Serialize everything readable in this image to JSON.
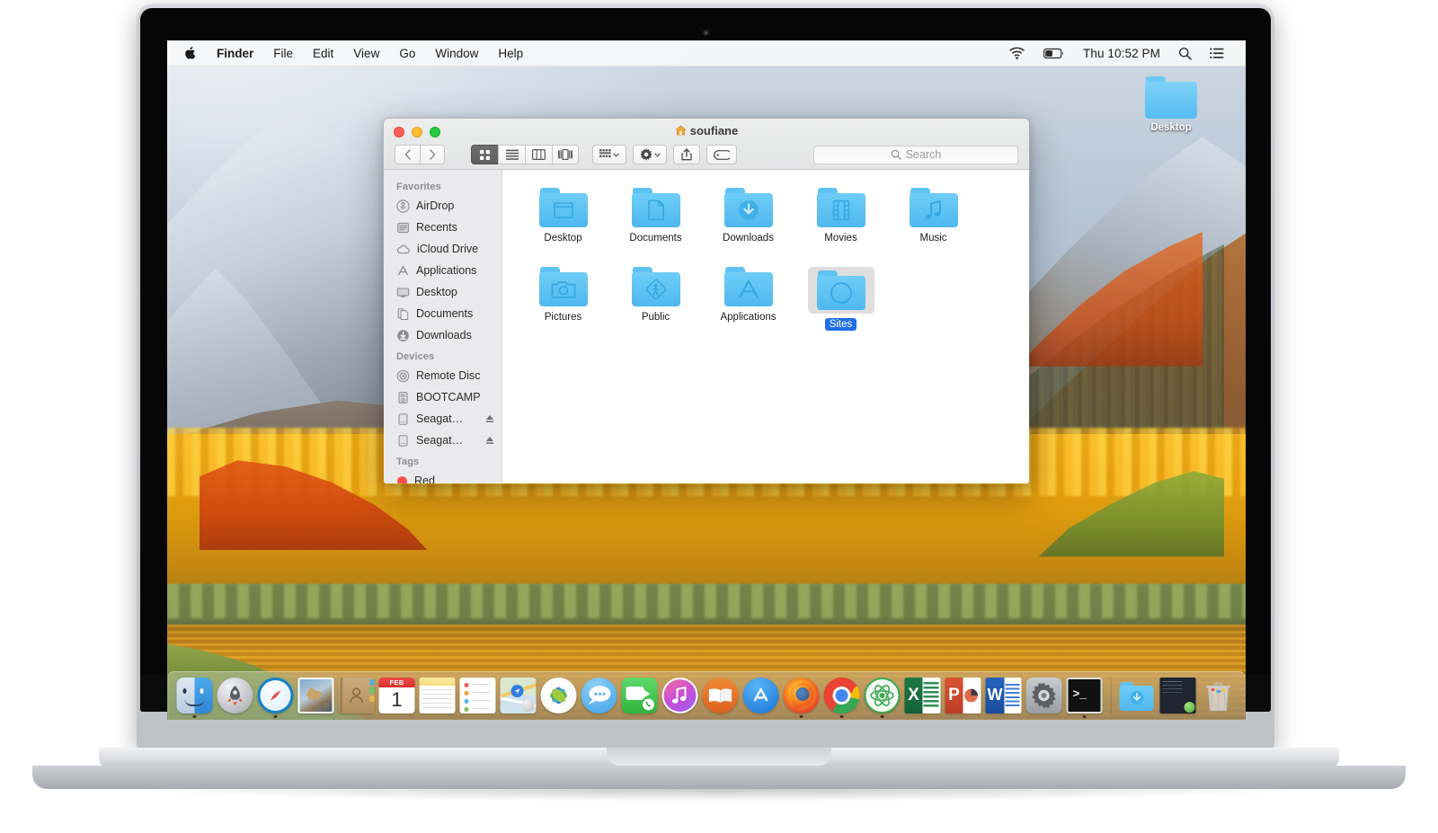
{
  "device": {
    "brand": "MacBook Pro"
  },
  "menubar": {
    "apple": "",
    "items": [
      {
        "label": "Finder",
        "bold": true
      },
      {
        "label": "File",
        "bold": false
      },
      {
        "label": "Edit",
        "bold": false
      },
      {
        "label": "View",
        "bold": false
      },
      {
        "label": "Go",
        "bold": false
      },
      {
        "label": "Window",
        "bold": false
      },
      {
        "label": "Help",
        "bold": false
      }
    ],
    "status": {
      "wifi_icon": "wifi-icon",
      "battery_icon": "battery-icon",
      "clock": "Thu 10:52 PM",
      "search_icon": "spotlight-search-icon",
      "list_icon": "notification-center-icon"
    }
  },
  "desktop": {
    "icons": [
      {
        "label": "Desktop",
        "type": "folder"
      }
    ]
  },
  "finder": {
    "title": "soufiane",
    "title_icon": "home-icon",
    "traffic": {
      "close": "close-button",
      "minimize": "minimize-button",
      "zoom": "zoom-button"
    },
    "toolbar": {
      "back": "back-button",
      "forward": "forward-button",
      "views": [
        {
          "name": "icon-view",
          "active": true
        },
        {
          "name": "list-view",
          "active": false
        },
        {
          "name": "column-view",
          "active": false
        },
        {
          "name": "gallery-view",
          "active": false
        }
      ],
      "arrange": "arrange-by-button",
      "action": "action-gear-button",
      "share": "share-button",
      "tags": "tags-button"
    },
    "search": {
      "placeholder": "Search",
      "value": ""
    },
    "sidebar": [
      {
        "header": "Favorites",
        "items": [
          {
            "label": "AirDrop",
            "icon": "airdrop-icon"
          },
          {
            "label": "Recents",
            "icon": "recents-icon"
          },
          {
            "label": "iCloud Drive",
            "icon": "icloud-icon"
          },
          {
            "label": "Applications",
            "icon": "applications-icon"
          },
          {
            "label": "Desktop",
            "icon": "desktop-icon"
          },
          {
            "label": "Documents",
            "icon": "documents-icon"
          },
          {
            "label": "Downloads",
            "icon": "downloads-icon"
          }
        ]
      },
      {
        "header": "Devices",
        "items": [
          {
            "label": "Remote Disc",
            "icon": "remote-disc-icon",
            "eject": false
          },
          {
            "label": "BOOTCAMP",
            "icon": "drive-icon",
            "eject": false
          },
          {
            "label": "Seagat…",
            "icon": "drive-icon",
            "eject": true
          },
          {
            "label": "Seagat…",
            "icon": "drive-icon",
            "eject": true
          }
        ]
      },
      {
        "header": "Tags",
        "items": [
          {
            "label": "Red",
            "icon": "red-tag-dot"
          }
        ]
      }
    ],
    "files": [
      {
        "label": "Desktop",
        "glyph": "window",
        "selected": false
      },
      {
        "label": "Documents",
        "glyph": "page",
        "selected": false
      },
      {
        "label": "Downloads",
        "glyph": "arrow",
        "selected": false
      },
      {
        "label": "Movies",
        "glyph": "film",
        "selected": false
      },
      {
        "label": "Music",
        "glyph": "note",
        "selected": false
      },
      {
        "label": "Pictures",
        "glyph": "camera",
        "selected": false
      },
      {
        "label": "Public",
        "glyph": "walker",
        "selected": false
      },
      {
        "label": "Applications",
        "glyph": "appstore",
        "selected": false
      },
      {
        "label": "Sites",
        "glyph": "compass",
        "selected": true
      }
    ]
  },
  "dock": {
    "items": [
      {
        "name": "finder",
        "label": "Finder",
        "running": true
      },
      {
        "name": "launchpad",
        "label": "Launchpad",
        "running": false
      },
      {
        "name": "safari",
        "label": "Safari",
        "running": true
      },
      {
        "name": "mail",
        "label": "Mail",
        "running": false
      },
      {
        "name": "contacts",
        "label": "Contacts",
        "running": false
      },
      {
        "name": "calendar",
        "label": "Calendar",
        "running": false
      },
      {
        "name": "notes",
        "label": "Notes",
        "running": false
      },
      {
        "name": "reminders",
        "label": "Reminders",
        "running": false
      },
      {
        "name": "maps",
        "label": "Maps",
        "running": false
      },
      {
        "name": "photos",
        "label": "Photos",
        "running": false
      },
      {
        "name": "messages",
        "label": "Messages",
        "running": false
      },
      {
        "name": "facetime",
        "label": "FaceTime",
        "running": false
      },
      {
        "name": "itunes",
        "label": "iTunes",
        "running": false
      },
      {
        "name": "ibooks",
        "label": "iBooks",
        "running": false
      },
      {
        "name": "appstore",
        "label": "App Store",
        "running": false
      },
      {
        "name": "firefox",
        "label": "Firefox",
        "running": true
      },
      {
        "name": "chrome",
        "label": "Google Chrome",
        "running": true
      },
      {
        "name": "atom",
        "label": "Atom",
        "running": true
      },
      {
        "name": "excel",
        "label": "Microsoft Excel",
        "running": false
      },
      {
        "name": "powerpoint",
        "label": "Microsoft PowerPoint",
        "running": false
      },
      {
        "name": "word",
        "label": "Microsoft Word",
        "running": false
      },
      {
        "name": "systemprefs",
        "label": "System Preferences",
        "running": false
      },
      {
        "name": "terminal",
        "label": "Terminal",
        "running": true
      }
    ],
    "right_items": [
      {
        "name": "downloads-stack",
        "label": "Downloads"
      },
      {
        "name": "document-stack",
        "label": "Documents"
      },
      {
        "name": "trash",
        "label": "Trash"
      }
    ]
  },
  "calendar": {
    "month": "FEB",
    "day": "1"
  },
  "colors": {
    "folder_blue": "#5ec3f2",
    "selection_blue": "#1f6fe5",
    "dock_bg": "rgba(245,245,245,0.30)",
    "menubar_bg": "rgba(246,247,249,0.93)"
  }
}
